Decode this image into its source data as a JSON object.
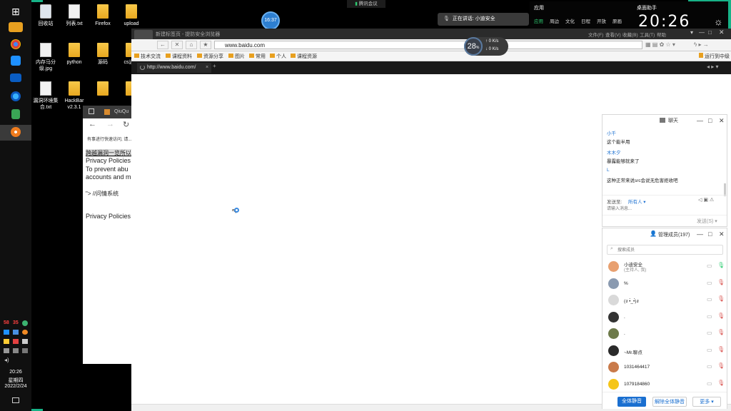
{
  "meeting_bar": {
    "label": "腾讯会议"
  },
  "speaking": {
    "text": "正在讲话: 小迪安全"
  },
  "timer_badge": {
    "value": "16:37"
  },
  "cpu_badge": {
    "value": "28",
    "unit": "%",
    "up": "0",
    "down": "0",
    "unit_up": "K/s",
    "unit_down": "K/s"
  },
  "clock_widget": {
    "menu": [
      "应用",
      "周边",
      "文化",
      "日程",
      "开放",
      "原画"
    ],
    "title": "桌面助手",
    "time": "20:26"
  },
  "desktop_icons": [
    {
      "label": "回收站",
      "kind": "recycle"
    },
    {
      "label": "列表.txt",
      "kind": "file"
    },
    {
      "label": "Firefox",
      "kind": "folder"
    },
    {
      "label": "upload",
      "kind": "folder"
    },
    {
      "label": "内存马分级.jpg",
      "kind": "file"
    },
    {
      "label": "python",
      "kind": "folder"
    },
    {
      "label": "源码",
      "kind": "folder"
    },
    {
      "label": "cs远控",
      "kind": "folder"
    },
    {
      "label": "漏洞环境集合.txt",
      "kind": "file"
    },
    {
      "label": "HackBar v2.3.1",
      "kind": "folder"
    },
    {
      "label": "",
      "kind": "folder"
    },
    {
      "label": "",
      "kind": "folder"
    }
  ],
  "taskbar": {
    "tray_numbers": [
      "58",
      "35"
    ],
    "time": "20:26",
    "weekday": "星期四",
    "date": "2022/2/24"
  },
  "old_window": {
    "tab": "QiuQu",
    "notice": "有事进行快速访问, 请...",
    "lines": [
      "跨越漏洞一览所以",
      "Privacy Policies",
      "To prevent abu",
      "accounts and m",
      "\"> //问情系统",
      "Privacy Policies"
    ]
  },
  "browser": {
    "title": "新建标签页 - 提防安全浏览器",
    "title_menu": [
      "文件(F)",
      "查看(V)",
      "收藏(B)",
      "工具(T)",
      "帮助"
    ],
    "address": "www.baidu.com",
    "favorites": [
      "技术交流",
      "课程资料",
      "资源分享",
      "图片",
      "常用",
      "个人",
      "课程资源"
    ],
    "fav_right": "运行到中级",
    "tab_url": "http://www.baidu.com/"
  },
  "chat": {
    "title": "聊天",
    "messages": [
      {
        "user": "小千",
        "text": "这个能半用"
      },
      {
        "user": "木木夕",
        "text": "暴露能够就来了"
      },
      {
        "user": "L",
        "text": "这种正常来说src会说无危害拒收吧"
      }
    ],
    "send_to_label": "发送至:",
    "send_to_value": "所有人",
    "input_placeholder": "请输入消息...",
    "send_button": "发送(S)"
  },
  "members": {
    "title": "管理成员(197)",
    "search_placeholder": "搜索成员",
    "list": [
      {
        "name": "小迪安全",
        "sub": "(主持人, 我)",
        "color": "#e8a070"
      },
      {
        "name": "%",
        "sub": "",
        "color": "#8a9ab0"
      },
      {
        "name": "(ง •̀_•́)ง",
        "sub": "",
        "color": "#d9d9d9"
      },
      {
        "name": ".",
        "sub": "",
        "color": "#333333"
      },
      {
        "name": ".",
        "sub": "",
        "color": "#6d7a4a"
      },
      {
        "name": "~Mr.聊点",
        "sub": "",
        "color": "#2a2a2a"
      },
      {
        "name": "1031464417",
        "sub": "",
        "color": "#c97a4a"
      },
      {
        "name": "1079184860",
        "sub": "",
        "color": "#f5c518"
      }
    ],
    "buttons": [
      "全体静音",
      "解除全体静音",
      "更多"
    ]
  }
}
